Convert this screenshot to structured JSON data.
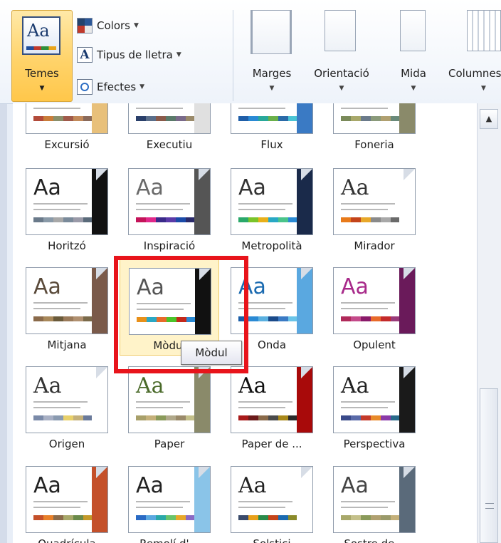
{
  "ribbon": {
    "themes_button": {
      "label": "Temes",
      "icon": "themes-icon"
    },
    "colors": {
      "label": "Colors",
      "icon": "colors-icon"
    },
    "fonts": {
      "label": "Tipus de lletra",
      "icon": "fonts-icon"
    },
    "effects": {
      "label": "Efectes",
      "icon": "effects-icon"
    },
    "margins": {
      "label": "Marges",
      "icon": "margins-icon"
    },
    "orientation": {
      "label": "Orientació",
      "icon": "orientation-icon"
    },
    "size": {
      "label": "Mida",
      "icon": "size-icon"
    },
    "columns": {
      "label": "Columnes",
      "icon": "columns-icon"
    }
  },
  "gallery": {
    "rows": [
      [
        {
          "name": "Excursió",
          "aa": "Aa",
          "font": "serif",
          "aa_color": "#333333",
          "side": "#e8c07a",
          "swatch": [
            "#b24a3a",
            "#c97d3a",
            "#8a8f6a",
            "#a05a4a",
            "#c28a5a",
            "#8a6a5a"
          ]
        },
        {
          "name": "Executiu",
          "aa": "Aa",
          "font": "sans",
          "aa_color": "#333333",
          "side": "#e0e0e0",
          "swatch": [
            "#2a3f6a",
            "#5a6e8a",
            "#8a5a4a",
            "#5a7a6a",
            "#7a6a8a",
            "#9a8a6a"
          ]
        },
        {
          "name": "Flux",
          "aa": "Aa",
          "font": "sans",
          "aa_color": "#333333",
          "side": "#3a7ac4",
          "swatch": [
            "#1f5ea8",
            "#2a8ad4",
            "#28a89a",
            "#6ab04a",
            "#2a6aa8",
            "#4ac4d4"
          ]
        },
        {
          "name": "Foneria",
          "aa": "Aa",
          "font": "sans",
          "aa_color": "#333333",
          "side": "#8a8a6a",
          "swatch": [
            "#7a8a5a",
            "#a8a86a",
            "#6a7a8a",
            "#8a9a7a",
            "#b0a070",
            "#6a8a7a"
          ]
        }
      ],
      [
        {
          "name": "Horitzó",
          "aa": "Aa",
          "font": "sans",
          "aa_color": "#222222",
          "side": "#111111",
          "swatch": [
            "#6a7a8a",
            "#8a9aa8",
            "#a8a8a8",
            "#7a8a9a",
            "#9a9aa8",
            "#5a6a7a"
          ]
        },
        {
          "name": "Inspiració",
          "aa": "Aa",
          "font": "sans",
          "aa_color": "#6a6a6a",
          "side": "#555555",
          "swatch": [
            "#c4145a",
            "#e0288a",
            "#3a2a8a",
            "#5a3aa8",
            "#1a4aa8",
            "#2a2a6a"
          ]
        },
        {
          "name": "Metropolità",
          "aa": "Aa",
          "font": "sans",
          "aa_color": "#333333",
          "side": "#1a2a4a",
          "swatch": [
            "#2aa86a",
            "#7ac42a",
            "#e8b01a",
            "#28a8c4",
            "#4ac48a",
            "#2a8ad4"
          ]
        },
        {
          "name": "Mirador",
          "aa": "Aa",
          "font": "serif",
          "aa_color": "#333333",
          "side": "#ffffff",
          "swatch": [
            "#e87a1a",
            "#c4441a",
            "#e8a82a",
            "#8a8a8a",
            "#a8a8a8",
            "#6a6a6a"
          ]
        }
      ],
      [
        {
          "name": "Mitjana",
          "aa": "Aa",
          "font": "sans",
          "aa_color": "#5a4a3a",
          "side": "#7a5a4a",
          "swatch": [
            "#8a6a4a",
            "#a8885a",
            "#6a5a3a",
            "#9a7a5a",
            "#b09070",
            "#7a6a4a"
          ]
        },
        {
          "name": "Mòdul",
          "aa": "Aa",
          "font": "sans",
          "aa_color": "#555555",
          "side": "#111111",
          "swatch": [
            "#e8901a",
            "#2aa8c4",
            "#e86a2a",
            "#4ac42a",
            "#c4281a",
            "#2a8ad4"
          ]
        },
        {
          "name": "Onda",
          "aa": "Aa",
          "font": "sans",
          "aa_color": "#1a6ab0",
          "side": "#5aa8e0",
          "swatch": [
            "#1a5ea8",
            "#2a8ad4",
            "#5ab0e0",
            "#1a4a8a",
            "#3a7ac4",
            "#6ac4e8"
          ]
        },
        {
          "name": "Opulent",
          "aa": "Aa",
          "font": "sans",
          "aa_color": "#a82a8a",
          "side": "#6a1a5a",
          "swatch": [
            "#b02a5a",
            "#c44a8a",
            "#8a1a6a",
            "#e86a2a",
            "#c42a2a",
            "#9a3a7a"
          ]
        }
      ],
      [
        {
          "name": "Origen",
          "aa": "Aa",
          "font": "serif",
          "aa_color": "#333333",
          "side": "#ffffff",
          "swatch": [
            "#7a8aa8",
            "#a8b0c4",
            "#8a9ab0",
            "#e8d06a",
            "#c4b07a",
            "#6a7a9a"
          ]
        },
        {
          "name": "Paper",
          "aa": "Aa",
          "font": "serif",
          "aa_color": "#4a6a2a",
          "side": "#8a8a6a",
          "swatch": [
            "#a8a06a",
            "#c4b07a",
            "#8a9a5a",
            "#b0a88a",
            "#9a8a6a",
            "#c4c08a"
          ]
        },
        {
          "name": "Paper de ...",
          "aa": "Aa",
          "font": "serif",
          "aa_color": "#111111",
          "side": "#a80a0a",
          "swatch": [
            "#a81a1a",
            "#6a1a1a",
            "#8a6a4a",
            "#4a4a4a",
            "#a8881a",
            "#2a2a2a"
          ]
        },
        {
          "name": "Perspectiva",
          "aa": "Aa",
          "font": "serif",
          "aa_color": "#222222",
          "side": "#1a1a1a",
          "swatch": [
            "#3a4a8a",
            "#5a6aa8",
            "#c43a2a",
            "#e88a2a",
            "#8a3aa8",
            "#2a6a8a"
          ]
        }
      ],
      [
        {
          "name": "Quadrícula",
          "aa": "Aa",
          "font": "sans",
          "aa_color": "#222222",
          "side": "#c4502a",
          "swatch": [
            "#c4502a",
            "#e8802a",
            "#8a6a4a",
            "#a8a86a",
            "#6a8a4a",
            "#c49a2a"
          ]
        },
        {
          "name": "Remolí d'...",
          "aa": "Aa",
          "font": "sans",
          "aa_color": "#222222",
          "side": "#8ac4e8",
          "swatch": [
            "#2a6ac4",
            "#5aa8e0",
            "#2aa8a8",
            "#6ac46a",
            "#e8a82a",
            "#8a6ac4"
          ]
        },
        {
          "name": "Solstici",
          "aa": "Aa",
          "font": "serif",
          "aa_color": "#222222",
          "side": "#ffffff",
          "swatch": [
            "#3a4a6a",
            "#e8a01a",
            "#2a8a4a",
            "#c4441a",
            "#1a6ab0",
            "#8a8a2a"
          ]
        },
        {
          "name": "Sostre de...",
          "aa": "Aa",
          "font": "sans",
          "aa_color": "#444444",
          "side": "#5a6a7a",
          "swatch": [
            "#a8a86a",
            "#c4c08a",
            "#8a9a5a",
            "#b0a070",
            "#9a9a6a",
            "#c4b07a"
          ]
        }
      ]
    ]
  },
  "tooltip": {
    "text": "Mòdul"
  },
  "colors": {
    "accent": "#ffd36a",
    "highlight": "#e8141b"
  }
}
